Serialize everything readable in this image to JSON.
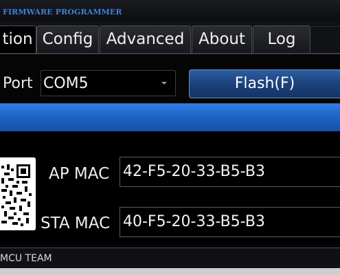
{
  "window": {
    "title": "FIRMWARE PROGRAMMER"
  },
  "tabs": [
    {
      "label": "tion",
      "active": true
    },
    {
      "label": "Config",
      "active": false
    },
    {
      "label": "Advanced",
      "active": false
    },
    {
      "label": "About",
      "active": false
    },
    {
      "label": "Log",
      "active": false
    }
  ],
  "port": {
    "label": "Port",
    "selected": "COM5"
  },
  "flash_button": {
    "label": "Flash(F)"
  },
  "progress": {
    "value": 1.0
  },
  "info": {
    "ap_mac_label": "AP MAC",
    "ap_mac_value": "42-F5-20-33-B5-B3",
    "sta_mac_label": "STA MAC",
    "sta_mac_value": "40-F5-20-33-B5-B3"
  },
  "status": {
    "text": "MCU TEAM"
  },
  "colors": {
    "accent": "#2b6bd0",
    "title_text": "#3f7fd6"
  }
}
